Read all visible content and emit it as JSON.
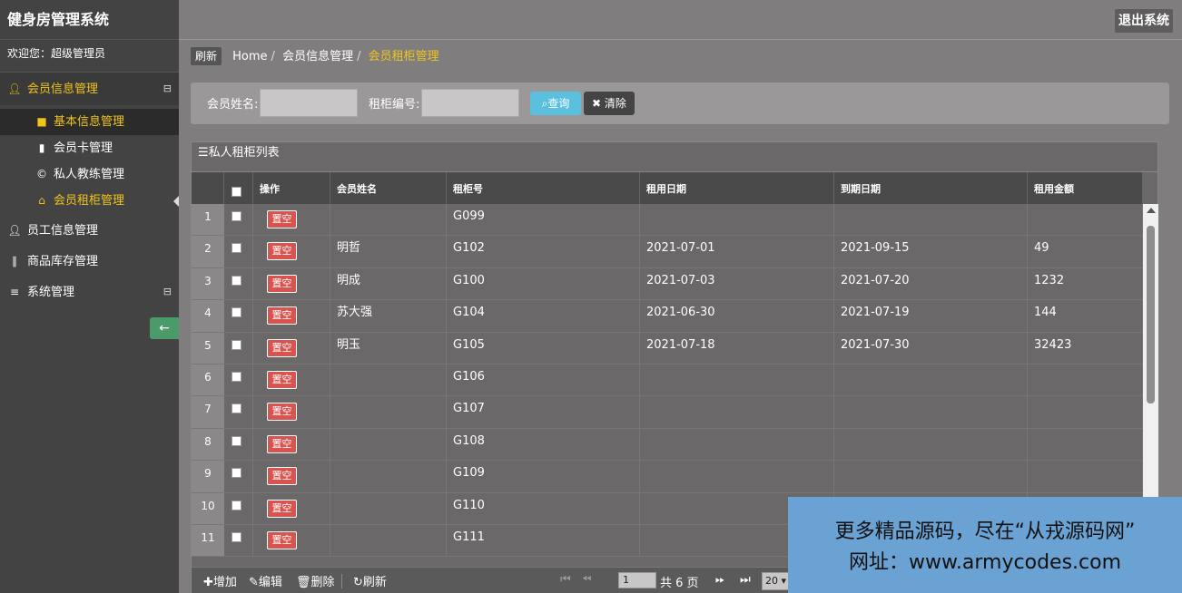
{
  "brand": "健身房管理系统",
  "welcome": "欢迎您：超级管理员",
  "logout_label": "退出系统",
  "sidebar": {
    "groups": [
      {
        "label": "会员信息管理",
        "toggle": "⊟"
      },
      {
        "label": "员工信息管理"
      },
      {
        "label": "商品库存管理"
      },
      {
        "label": "系统管理",
        "toggle": "⊟"
      }
    ],
    "subitems": [
      {
        "label": "基本信息管理"
      },
      {
        "label": "会员卡管理"
      },
      {
        "label": "私人教练管理"
      },
      {
        "label": "会员租柜管理"
      }
    ]
  },
  "breadcrumb": {
    "refresh": "刷新",
    "home": "Home",
    "parent": "会员信息管理",
    "current": "会员租柜管理",
    "sep": "/"
  },
  "search": {
    "name_label": "会员姓名:",
    "cabinet_label": "租柜编号:",
    "name_value": "",
    "cabinet_value": "",
    "query_label": "查询",
    "clear_label": "清除"
  },
  "grid": {
    "title": "私人租柜列表",
    "columns": [
      "操作",
      "会员姓名",
      "租柜号",
      "租用日期",
      "到期日期",
      "租用金额"
    ],
    "action_label": "置空",
    "rows": [
      {
        "num": "1",
        "name": "",
        "cabinet": "G099",
        "start": "",
        "end": "",
        "amount": ""
      },
      {
        "num": "2",
        "name": "明哲",
        "cabinet": "G102",
        "start": "2021-07-01",
        "end": "2021-09-15",
        "amount": "49"
      },
      {
        "num": "3",
        "name": "明成",
        "cabinet": "G100",
        "start": "2021-07-03",
        "end": "2021-07-20",
        "amount": "1232"
      },
      {
        "num": "4",
        "name": "苏大强",
        "cabinet": "G104",
        "start": "2021-06-30",
        "end": "2021-07-19",
        "amount": "144"
      },
      {
        "num": "5",
        "name": "明玉",
        "cabinet": "G105",
        "start": "2021-07-18",
        "end": "2021-07-30",
        "amount": "32423"
      },
      {
        "num": "6",
        "name": "",
        "cabinet": "G106",
        "start": "",
        "end": "",
        "amount": ""
      },
      {
        "num": "7",
        "name": "",
        "cabinet": "G107",
        "start": "",
        "end": "",
        "amount": ""
      },
      {
        "num": "8",
        "name": "",
        "cabinet": "G108",
        "start": "",
        "end": "",
        "amount": ""
      },
      {
        "num": "9",
        "name": "",
        "cabinet": "G109",
        "start": "",
        "end": "",
        "amount": ""
      },
      {
        "num": "10",
        "name": "",
        "cabinet": "G110",
        "start": "",
        "end": "",
        "amount": ""
      },
      {
        "num": "11",
        "name": "",
        "cabinet": "G111",
        "start": "",
        "end": "",
        "amount": ""
      }
    ]
  },
  "toolbar": {
    "add": "增加",
    "edit": "编辑",
    "delete": "删除",
    "refresh": "刷新",
    "page_value": "1",
    "page_total": "共 6 页",
    "page_size": "20"
  },
  "watermark": {
    "line1": "更多精品源码，尽在“从戎源码网”",
    "line2": "网址：www.armycodes.com"
  },
  "colors": {
    "accent": "#f0c419",
    "sidebar_bg": "#434343",
    "danger": "#d9534f",
    "info": "#5bc0de"
  }
}
